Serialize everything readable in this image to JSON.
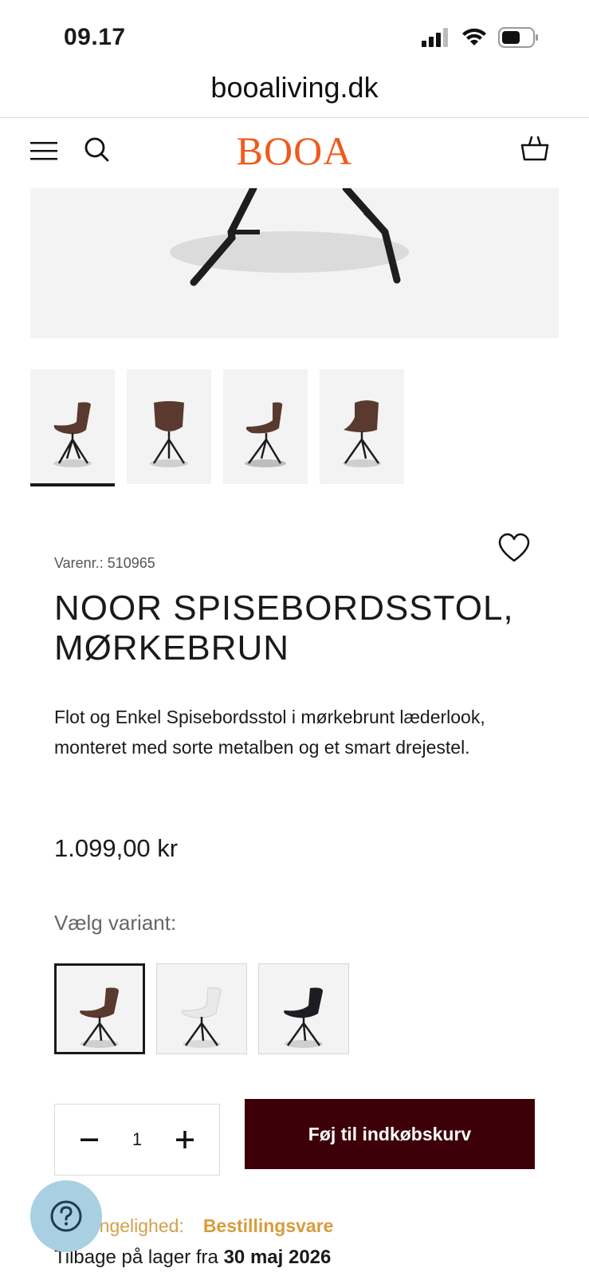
{
  "status_bar": {
    "time": "09.17"
  },
  "browser": {
    "url": "booaliving.dk"
  },
  "header": {
    "logo": "BOOA"
  },
  "product": {
    "sku": "Varenr.: 510965",
    "title": "NOOR SPISEBORDSSTOL, MØRKEBRUN",
    "description": "Flot og Enkel Spisebordsstol i mørkebrunt læderlook, monteret med sorte metalben og et smart drejestel.",
    "price": "1.099,00 kr",
    "variant_label": "Vælg variant:",
    "variants": [
      {
        "color": "#5a3a2e",
        "name": "dark-brown"
      },
      {
        "color": "#e9e9e9",
        "name": "white"
      },
      {
        "color": "#1b1d22",
        "name": "black"
      }
    ],
    "quantity": "1",
    "add_to_cart": "Føj til indkøbskurv",
    "availability_label": "Tilgængelighed:",
    "availability_value": "Bestillingsvare",
    "restock_prefix": "Tilbage på lager fra",
    "restock_date": "30 maj 2026"
  },
  "icons": {
    "menu": "hamburger-icon",
    "search": "search-icon",
    "cart": "basket-icon",
    "wishlist": "heart-icon",
    "help": "question-icon"
  },
  "colors": {
    "brand": "#f05a1a",
    "cta": "#3d0008",
    "availability": "#d89c3d",
    "help_bubble": "#a9cfe3"
  }
}
